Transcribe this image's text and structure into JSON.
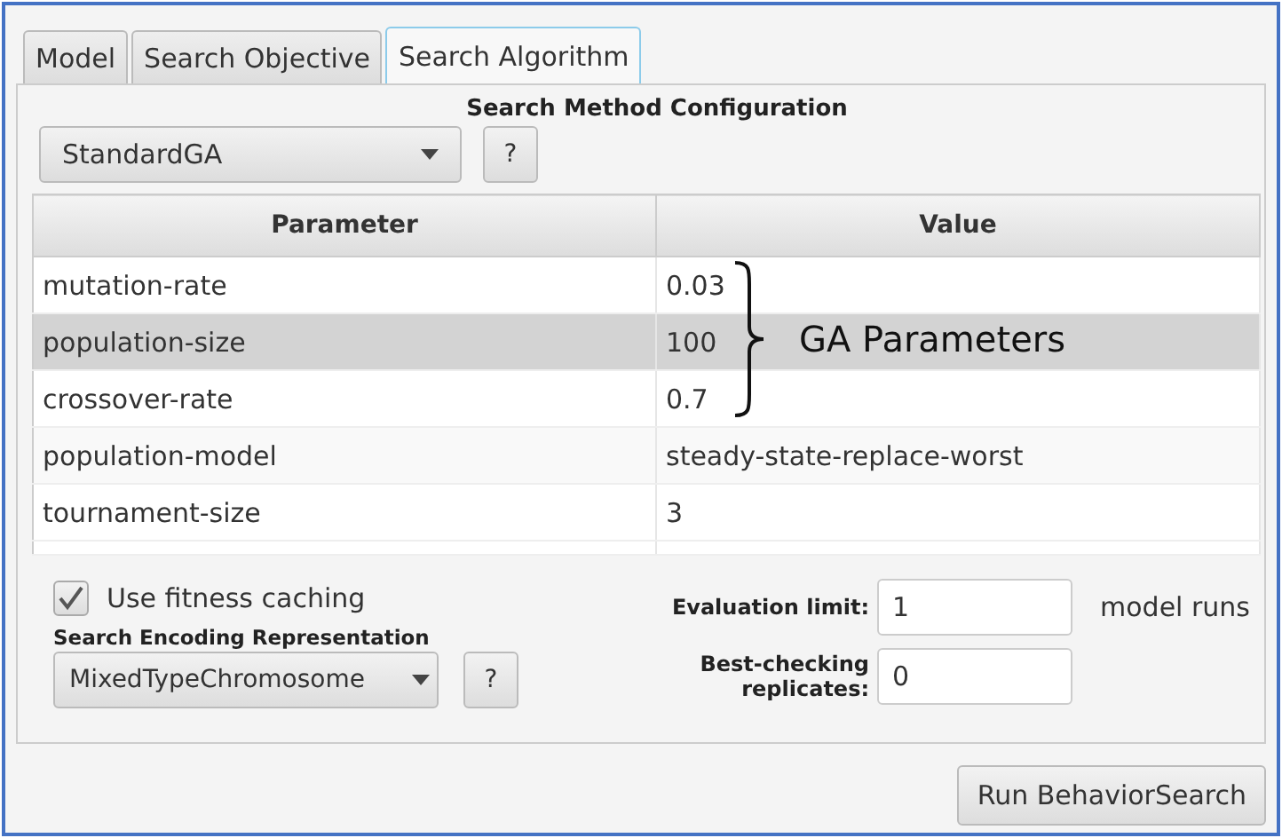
{
  "tabs": [
    {
      "label": "Model",
      "selected": false
    },
    {
      "label": "Search Objective",
      "selected": false
    },
    {
      "label": "Search Algorithm",
      "selected": true
    }
  ],
  "section_title": "Search Method Configuration",
  "method_dropdown": {
    "value": "StandardGA"
  },
  "method_help_button": "?",
  "table": {
    "columns": [
      "Parameter",
      "Value"
    ],
    "rows": [
      {
        "cells": [
          "mutation-rate",
          "0.03"
        ],
        "selected": false
      },
      {
        "cells": [
          "population-size",
          "100"
        ],
        "selected": true
      },
      {
        "cells": [
          "crossover-rate",
          "0.7"
        ],
        "selected": false
      },
      {
        "cells": [
          "population-model",
          "steady-state-replace-worst"
        ],
        "selected": false
      },
      {
        "cells": [
          "tournament-size",
          "3"
        ],
        "selected": false
      }
    ]
  },
  "annotation": {
    "label": "GA Parameters"
  },
  "fitness_caching": {
    "label": "Use fitness caching",
    "checked": true
  },
  "encoding_title": "Search Encoding Representation",
  "encoding_dropdown": {
    "value": "MixedTypeChromosome"
  },
  "encoding_help_button": "?",
  "evaluation_limit": {
    "label": "Evaluation limit:",
    "value": "1",
    "unit": "model runs"
  },
  "best_checking": {
    "label": "Best-checking replicates:",
    "value": "0"
  },
  "run_button": "Run BehaviorSearch"
}
